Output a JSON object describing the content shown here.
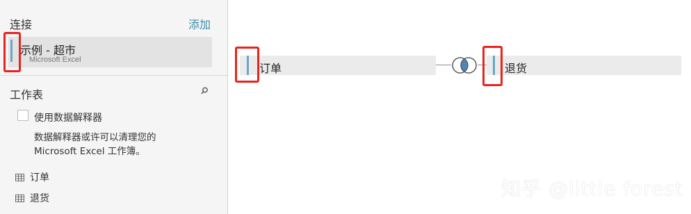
{
  "sidebar": {
    "connections_title": "连接",
    "add_label": "添加",
    "connection": {
      "name": "示例 - 超市",
      "type": "Microsoft Excel"
    },
    "worksheets_title": "工作表",
    "interpreter": {
      "checkbox_label": "使用数据解释器",
      "description": "数据解释器或许可以清理您的 Microsoft Excel 工作簿。"
    },
    "sheets": [
      {
        "label": "订单",
        "icon": "table-icon"
      },
      {
        "label": "退货",
        "icon": "table-icon"
      }
    ]
  },
  "canvas": {
    "left_table": "订单",
    "right_table": "退货",
    "join_type": "inner-join-icon"
  },
  "watermark": "知乎 @little forest",
  "colors": {
    "accent": "#3a8dab",
    "table_bar": "#6aa6c6",
    "highlight": "#e8231d",
    "join_fill": "#4f86b6"
  }
}
